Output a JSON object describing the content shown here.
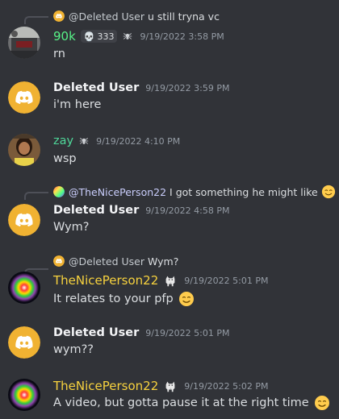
{
  "colors": {
    "background": "#313338",
    "discord_blurple_alt": "#f0b232",
    "name_green": "#57f287",
    "name_teal": "#4fd89a",
    "name_gold": "#f7d23e"
  },
  "messages": [
    {
      "reply": {
        "mention": "@Deleted User",
        "text": "u still tryna vc"
      },
      "author": "90k",
      "badge": "333",
      "timestamp": "9/19/2022 3:58 PM",
      "content": "rn",
      "avatar_icon": "photo-avatar-icon",
      "decoration_icon": "spider-icon"
    },
    {
      "author": "Deleted User",
      "timestamp": "9/19/2022 3:59 PM",
      "content": "i'm here",
      "avatar_icon": "discord-logo-icon"
    },
    {
      "author": "zay",
      "timestamp": "9/19/2022 4:10 PM",
      "content": "wsp",
      "avatar_icon": "photo-avatar-icon",
      "decoration_icon": "spider-icon"
    },
    {
      "reply": {
        "mention": "@TheNicePerson22",
        "text": "I got something he might like"
      },
      "author": "Deleted User",
      "timestamp": "9/19/2022 4:58 PM",
      "content": "Wym?",
      "avatar_icon": "discord-logo-icon"
    },
    {
      "reply": {
        "mention": "@Deleted User",
        "text": "Wym?"
      },
      "author": "TheNicePerson22",
      "timestamp": "9/19/2022 5:01 PM",
      "content": "It relates to your pfp",
      "avatar_icon": "rainbow-avatar-icon",
      "decoration_icon": "goat-icon"
    },
    {
      "author": "Deleted User",
      "timestamp": "9/19/2022 5:01 PM",
      "content": "wym??",
      "avatar_icon": "discord-logo-icon"
    },
    {
      "author": "TheNicePerson22",
      "timestamp": "9/19/2022 5:02 PM",
      "content": "A video, but gotta pause it at the right time",
      "avatar_icon": "rainbow-avatar-icon",
      "decoration_icon": "goat-icon"
    }
  ]
}
